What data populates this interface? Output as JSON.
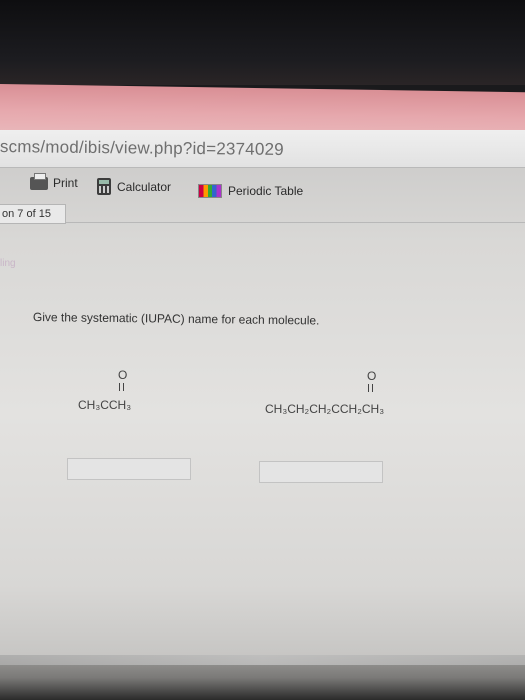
{
  "browser": {
    "url_fragment": "scms/mod/ibis/view.php?id=2374029"
  },
  "toolbar": {
    "print_label": "Print",
    "calculator_label": "Calculator",
    "periodic_table_label": "Periodic Table"
  },
  "question_nav": {
    "label": "on 7 of 15"
  },
  "faint_label": "ling",
  "question": {
    "prompt": "Give the systematic (IUPAC) name for each molecule.",
    "molecules": [
      {
        "carbonyl_o": "O",
        "formula": "CH₃CCH₃"
      },
      {
        "carbonyl_o": "O",
        "formula": "CH₃CH₂CH₂CCH₂CH₃"
      }
    ],
    "answers": [
      "",
      ""
    ]
  }
}
